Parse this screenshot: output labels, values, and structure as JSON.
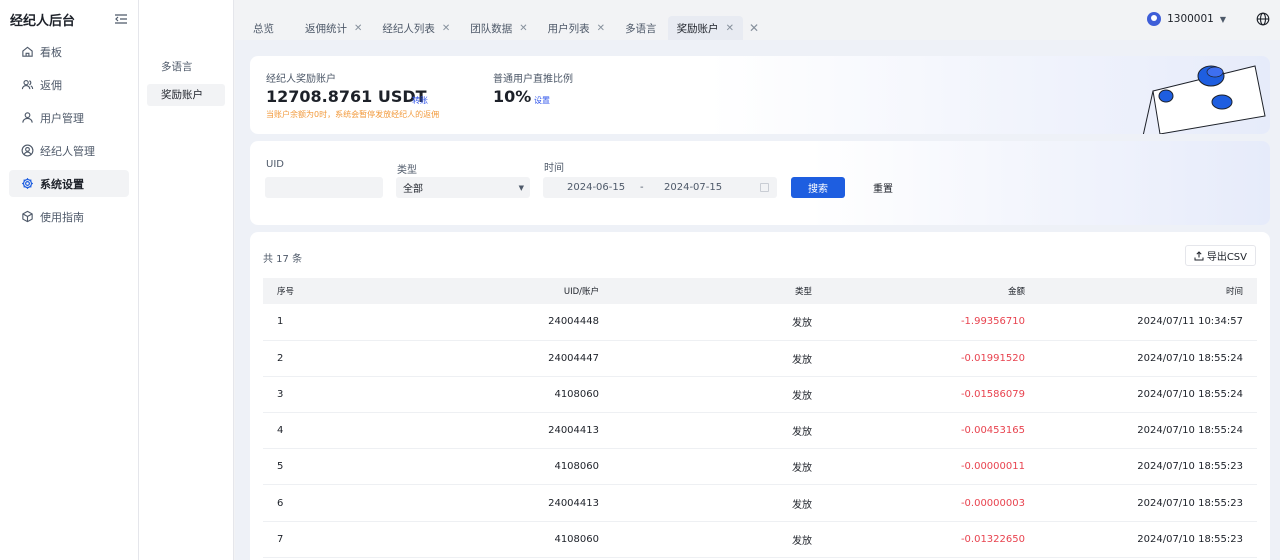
{
  "sidebar": {
    "brand": "经纪人后台",
    "items": [
      {
        "label": "看板",
        "icon": "home-icon",
        "active": false
      },
      {
        "label": "返佣",
        "icon": "users-icon",
        "active": false
      },
      {
        "label": "用户管理",
        "icon": "user-icon",
        "active": false
      },
      {
        "label": "经纪人管理",
        "icon": "user-circle-icon",
        "active": false
      },
      {
        "label": "系统设置",
        "icon": "gear-icon",
        "active": true
      },
      {
        "label": "使用指南",
        "icon": "cube-icon",
        "active": false
      }
    ]
  },
  "subnav": {
    "items": [
      {
        "label": "多语言",
        "active": false
      },
      {
        "label": "奖励账户",
        "active": true
      }
    ]
  },
  "tabs": [
    {
      "label": "总览",
      "closable": false
    },
    {
      "label": "返佣统计",
      "closable": true
    },
    {
      "label": "经纪人列表",
      "closable": true
    },
    {
      "label": "团队数据",
      "closable": true
    },
    {
      "label": "用户列表",
      "closable": true
    },
    {
      "label": "多语言",
      "closable": true
    },
    {
      "label": "奖励账户",
      "closable": true,
      "active": true
    }
  ],
  "topbar": {
    "username": "1300001"
  },
  "balance": {
    "label": "经纪人奖励账户",
    "value": "12708.8761 USDT",
    "transfer_link": "转账",
    "warning": "当账户余额为0时，系统会暂停发放经纪人的返佣"
  },
  "ratio": {
    "label": "普通用户直推比例",
    "value": "10%",
    "settings_link": "设置"
  },
  "filter": {
    "uid_label": "UID",
    "uid_value": "",
    "type_label": "类型",
    "type_value": "全部",
    "time_label": "时间",
    "date_start": "2024-06-15",
    "date_sep": "-",
    "date_end": "2024-07-15",
    "search_label": "搜索",
    "reset_label": "重置"
  },
  "table": {
    "total_text": "共 17 条",
    "export_label": "导出CSV",
    "columns": [
      "序号",
      "UID/账户",
      "类型",
      "金额",
      "时间"
    ],
    "rows": [
      [
        "1",
        "24004448",
        "发放",
        "-1.99356710",
        "2024/07/11 10:34:57"
      ],
      [
        "2",
        "24004447",
        "发放",
        "-0.01991520",
        "2024/07/10 18:55:24"
      ],
      [
        "3",
        "4108060",
        "发放",
        "-0.01586079",
        "2024/07/10 18:55:24"
      ],
      [
        "4",
        "24004413",
        "发放",
        "-0.00453165",
        "2024/07/10 18:55:24"
      ],
      [
        "5",
        "4108060",
        "发放",
        "-0.00000011",
        "2024/07/10 18:55:23"
      ],
      [
        "6",
        "24004413",
        "发放",
        "-0.00000003",
        "2024/07/10 18:55:23"
      ],
      [
        "7",
        "4108060",
        "发放",
        "-0.01322650",
        "2024/07/10 18:55:23"
      ]
    ]
  },
  "colors": {
    "accent": "#1e5ee0",
    "negative": "#e8434f",
    "warning": "#f29a3c"
  }
}
